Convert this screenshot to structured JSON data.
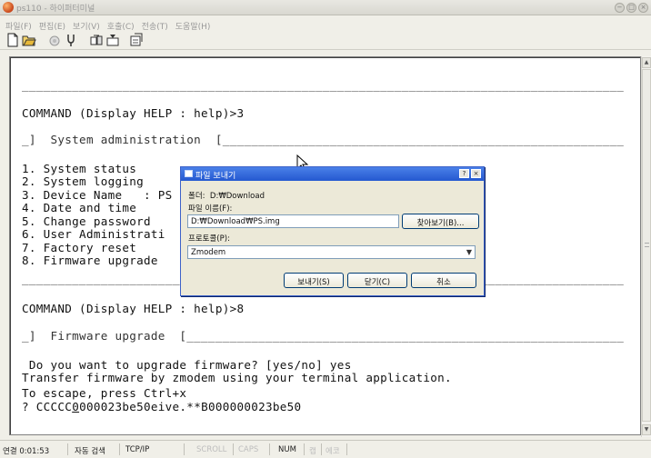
{
  "window": {
    "title": "ps110 - 하이퍼터미널",
    "controls": [
      "−",
      "□",
      "×"
    ]
  },
  "menu": [
    "파일(F)",
    "편집(E)",
    "보기(V)",
    "호출(C)",
    "전송(T)",
    "도움말(H)"
  ],
  "toolbar": {
    "icons": [
      "new-connection-icon",
      "open-icon",
      "call-icon",
      "disconnect-icon",
      "send-icon",
      "receive-icon",
      "properties-icon"
    ]
  },
  "terminal": {
    "dash_line": "____________________________________________________________________________________________________",
    "prompt1": "COMMAND (Display HELP : help)>3",
    "section1": "_]  System administration  [__________________________________________________________________",
    "menu_items": [
      "1. System status",
      "2. System logging",
      "3. Device Name   : PS",
      "4. Date and time",
      "5. Change password",
      "6. User Administrati",
      "7. Factory reset",
      "8. Firmware upgrade"
    ],
    "prompt2": "COMMAND (Display HELP : help)>8",
    "section2": "_]  Firmware upgrade  [_______________________________________________________________________",
    "question": " Do you want to upgrade firmware? [yes/no] yes",
    "transfer": "Transfer firmware by zmodem using your terminal application.",
    "escape": "To escape, press Ctrl+x",
    "zmodem_prefix": "? CCCCC",
    "zmodem_cursor": "0",
    "zmodem_rest": "000023be50eive.**B000000023be50"
  },
  "dialog": {
    "title": "파일 보내기",
    "help_btn": "?",
    "close_btn": "×",
    "folder_label": "폴더:",
    "folder_value": "D:₩Download",
    "filename_label": "파일 이름(F):",
    "filename_value": "D:₩Download₩PS.img",
    "browse_label": "찾아보기(B)...",
    "protocol_label": "프로토콜(P):",
    "protocol_value": "Zmodem",
    "send_label": "보내기(S)",
    "close_label": "닫기(C)",
    "cancel_label": "취소"
  },
  "status": {
    "connected": "연결 0:01:53",
    "detect": "자동 검색",
    "protocol": "TCP/IP",
    "scroll": "SCROLL",
    "caps": "CAPS",
    "num": "NUM",
    "capture": "캡",
    "echo": "에코"
  }
}
